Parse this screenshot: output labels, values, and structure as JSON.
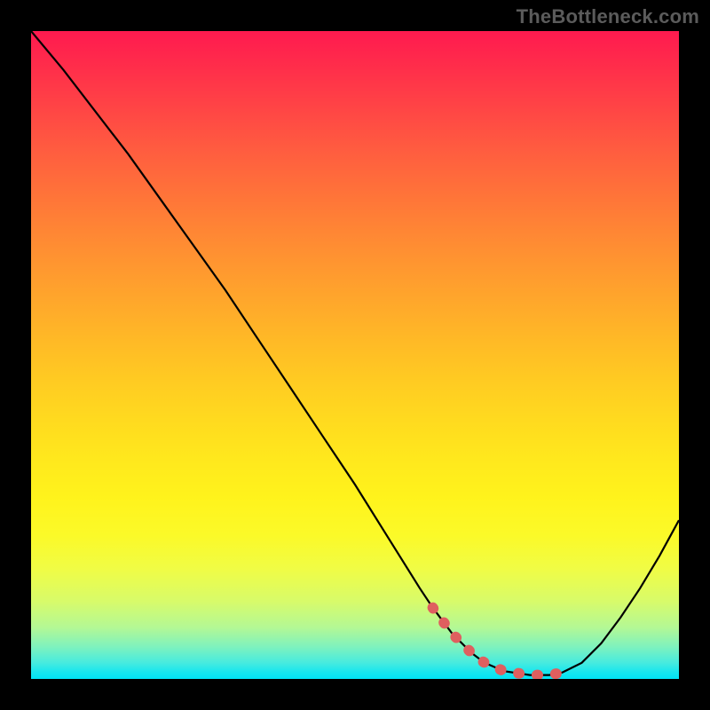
{
  "watermark": "TheBottleneck.com",
  "chart_data": {
    "type": "line",
    "title": "",
    "xlabel": "",
    "ylabel": "",
    "xlim": [
      0,
      100
    ],
    "ylim": [
      0,
      100
    ],
    "grid": false,
    "background_gradient": {
      "top_color": "#ff1a4f",
      "bottom_color": "#00e3f5",
      "description": "vertical red-orange-yellow-green-cyan gradient (bottleneck heat style)"
    },
    "series": [
      {
        "name": "bottleneck-curve",
        "color": "#000000",
        "x": [
          0,
          5,
          10,
          15,
          20,
          25,
          30,
          35,
          40,
          45,
          50,
          55,
          60,
          62,
          65,
          68,
          70,
          73,
          77,
          80,
          82,
          85,
          88,
          91,
          94,
          97,
          100
        ],
        "y": [
          100,
          94,
          87.5,
          81,
          74,
          67,
          60,
          52.5,
          45,
          37.5,
          30,
          22,
          14,
          11,
          7,
          4,
          2.5,
          1.2,
          0.6,
          0.6,
          1,
          2.5,
          5.5,
          9.5,
          14,
          19,
          24.5
        ]
      }
    ],
    "highlight": {
      "name": "optimal-range-marker",
      "color": "#df5f5f",
      "style": "thick-dotted",
      "x_range": [
        62,
        83
      ],
      "y_approx": 0.9,
      "description": "thick coral dotted segment marking the trough/optimal region of the curve"
    }
  }
}
